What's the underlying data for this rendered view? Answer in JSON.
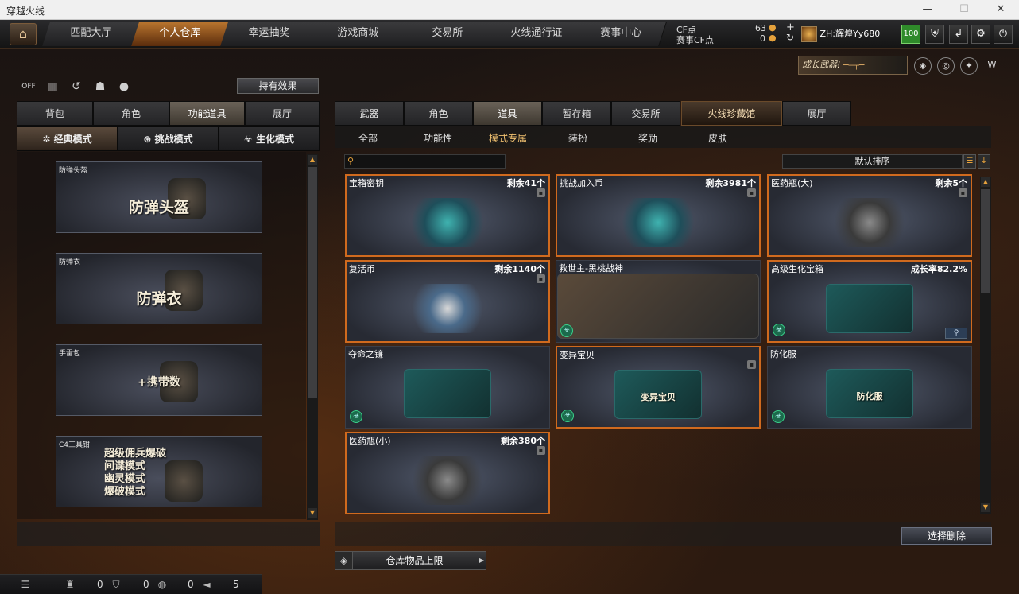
{
  "window": {
    "title": "穿越火线",
    "controls": [
      "—",
      "☐",
      "✕"
    ]
  },
  "topnav": {
    "tabs": [
      "匹配大厅",
      "个人仓库",
      "幸运抽奖",
      "游戏商城",
      "交易所",
      "火线通行证",
      "赛事中心"
    ],
    "active_index": 1,
    "cf_label": "CF点",
    "cf_value": "63",
    "match_cf_label": "赛事CF点",
    "match_cf_value": "0",
    "username": "ZH:辉煌Yy680",
    "level": "100"
  },
  "promo": {
    "label": "成长武器!"
  },
  "left": {
    "effect_button": "持有效果",
    "tabs": [
      "背包",
      "角色",
      "功能道具",
      "展厅"
    ],
    "active_tab": 2,
    "modes": [
      "经典模式",
      "挑战模式",
      "生化模式"
    ],
    "active_mode": 0,
    "items": [
      {
        "caption": "防弹头盔",
        "big": "防弹头盔"
      },
      {
        "caption": "防弹衣",
        "big": "防弹衣"
      },
      {
        "caption": "手雷包",
        "big": "+携带数"
      },
      {
        "caption": "C4工具钳",
        "lines": [
          "超级佣兵爆破",
          "间谍模式",
          "幽灵模式",
          "爆破模式"
        ]
      }
    ]
  },
  "right": {
    "tabs": [
      "武器",
      "角色",
      "道具",
      "暂存箱",
      "交易所",
      "火线珍藏馆",
      "展厅"
    ],
    "active_tab": 2,
    "subtabs": [
      "全部",
      "功能性",
      "模式专属",
      "装扮",
      "奖励",
      "皮肤"
    ],
    "active_subtab": 2,
    "search_placeholder": "",
    "sort_label": "默认排序",
    "items": [
      {
        "name": "宝箱密钥",
        "count": "剩余41个"
      },
      {
        "name": "挑战加入币",
        "count": "剩余3981个"
      },
      {
        "name": "医药瓶(大)",
        "count": "剩余5个"
      },
      {
        "name": "复活币",
        "count": "剩余1140个"
      },
      {
        "name": "救世主-黑桃战神",
        "count": ""
      },
      {
        "name": "高级生化宝箱",
        "count": "成长率82.2%"
      },
      {
        "name": "夺命之镰",
        "count": ""
      },
      {
        "name": "变异宝贝",
        "count": "",
        "art_text": "变异宝贝"
      },
      {
        "name": "防化服",
        "count": "",
        "art_text": "防化服"
      },
      {
        "name": "医药瓶(小)",
        "count": "剩余380个"
      }
    ],
    "delete_button": "选择删除",
    "capacity_button": "仓库物品上限"
  },
  "statusbar": {
    "values": [
      "0",
      "0",
      "0",
      "5"
    ]
  },
  "icons": {
    "home": "home-icon",
    "coin": "coin-icon",
    "plus": "plus-icon",
    "refresh": "refresh-icon",
    "search": "search-icon",
    "lock": "lock-icon",
    "zombie": "zombie-mode-icon",
    "zoom": "zoom-icon"
  },
  "colors": {
    "accent": "#d06a1e",
    "active_tab": "#b8742e",
    "level": "#2f8a2a"
  }
}
